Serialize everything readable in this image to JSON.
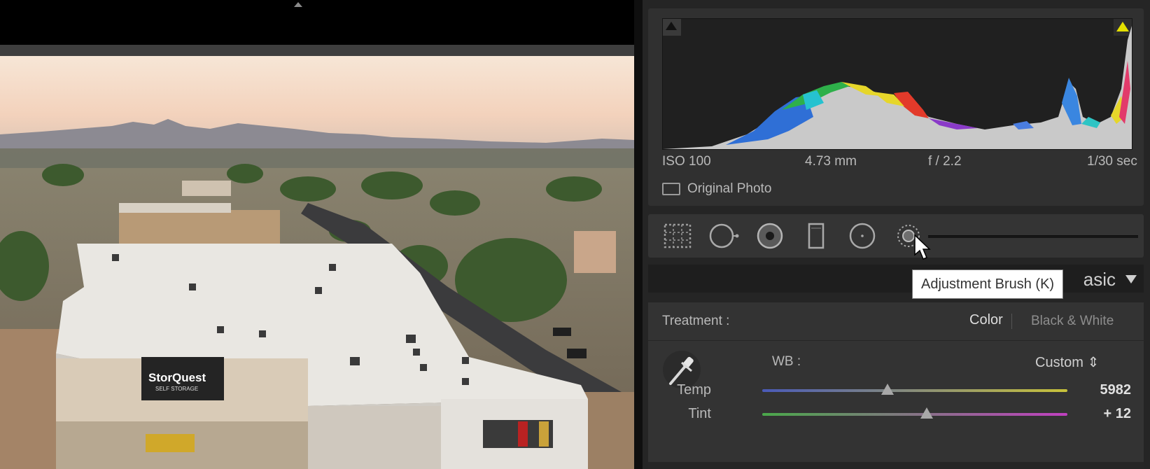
{
  "histogram": {
    "iso": "ISO 100",
    "focal_length": "4.73 mm",
    "aperture": "f / 2.2",
    "shutter": "1/30 sec",
    "original_photo_label": "Original Photo"
  },
  "tools": [
    {
      "name": "crop-overlay"
    },
    {
      "name": "spot-removal"
    },
    {
      "name": "red-eye-correction"
    },
    {
      "name": "graduated-filter"
    },
    {
      "name": "radial-filter"
    },
    {
      "name": "adjustment-brush"
    }
  ],
  "tooltip": {
    "text": "Adjustment Brush (K)"
  },
  "basic": {
    "title": "asic",
    "treatment_label": "Treatment :",
    "treatment_color": "Color",
    "treatment_bw": "Black & White",
    "wb_label": "WB :",
    "wb_value": "Custom ⇕",
    "sliders": [
      {
        "label": "Temp",
        "value": "5982",
        "position": 0.41
      },
      {
        "label": "Tint",
        "value": "+ 12",
        "position": 0.54
      }
    ]
  },
  "colors": {
    "temp_track_left": "#4a5ab8",
    "temp_track_right": "#c8c23a",
    "tint_track_left": "#4aa84a",
    "tint_track_right": "#c040c0",
    "clip_highlight": "#e4e000"
  },
  "photo": {
    "sign_text": "StorQuest",
    "sign_subtext": "SELF STORAGE"
  }
}
